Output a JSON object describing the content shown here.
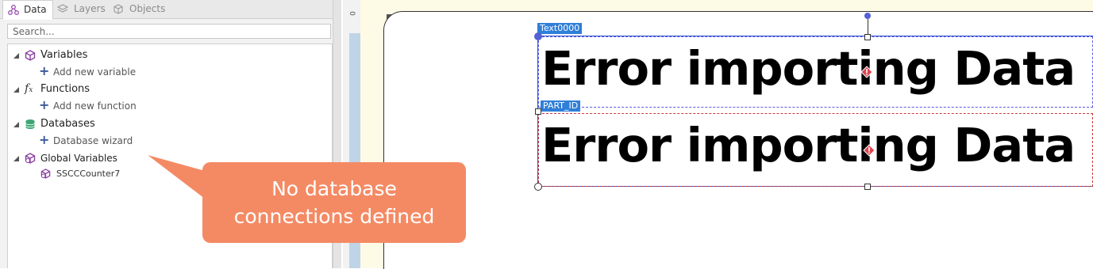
{
  "tabs": [
    {
      "label": "Data",
      "icon": "data-icon",
      "active": true
    },
    {
      "label": "Layers",
      "icon": "layers-icon",
      "active": false
    },
    {
      "label": "Objects",
      "icon": "objects-icon",
      "active": false
    }
  ],
  "search": {
    "placeholder": "Search..."
  },
  "tree": {
    "variables": {
      "label": "Variables",
      "add_label": "Add new variable"
    },
    "functions": {
      "label": "Functions",
      "add_label": "Add new function"
    },
    "databases": {
      "label": "Databases",
      "add_label": "Database wizard"
    },
    "global_variables": {
      "label": "Global Variables",
      "items": [
        "SSCCCounter7"
      ]
    }
  },
  "callout": {
    "line1": "No database",
    "line2": "connections defined",
    "color": "#f48a64"
  },
  "ruler": {
    "zero": "0"
  },
  "label_objects": [
    {
      "tag": "Text0000",
      "text": "Error importing Data So"
    },
    {
      "tag": "PART_ID",
      "text": "Error importing Data So"
    }
  ],
  "colors": {
    "selection_tag": "#2f7fd8",
    "accent_red": "#e0454f"
  }
}
